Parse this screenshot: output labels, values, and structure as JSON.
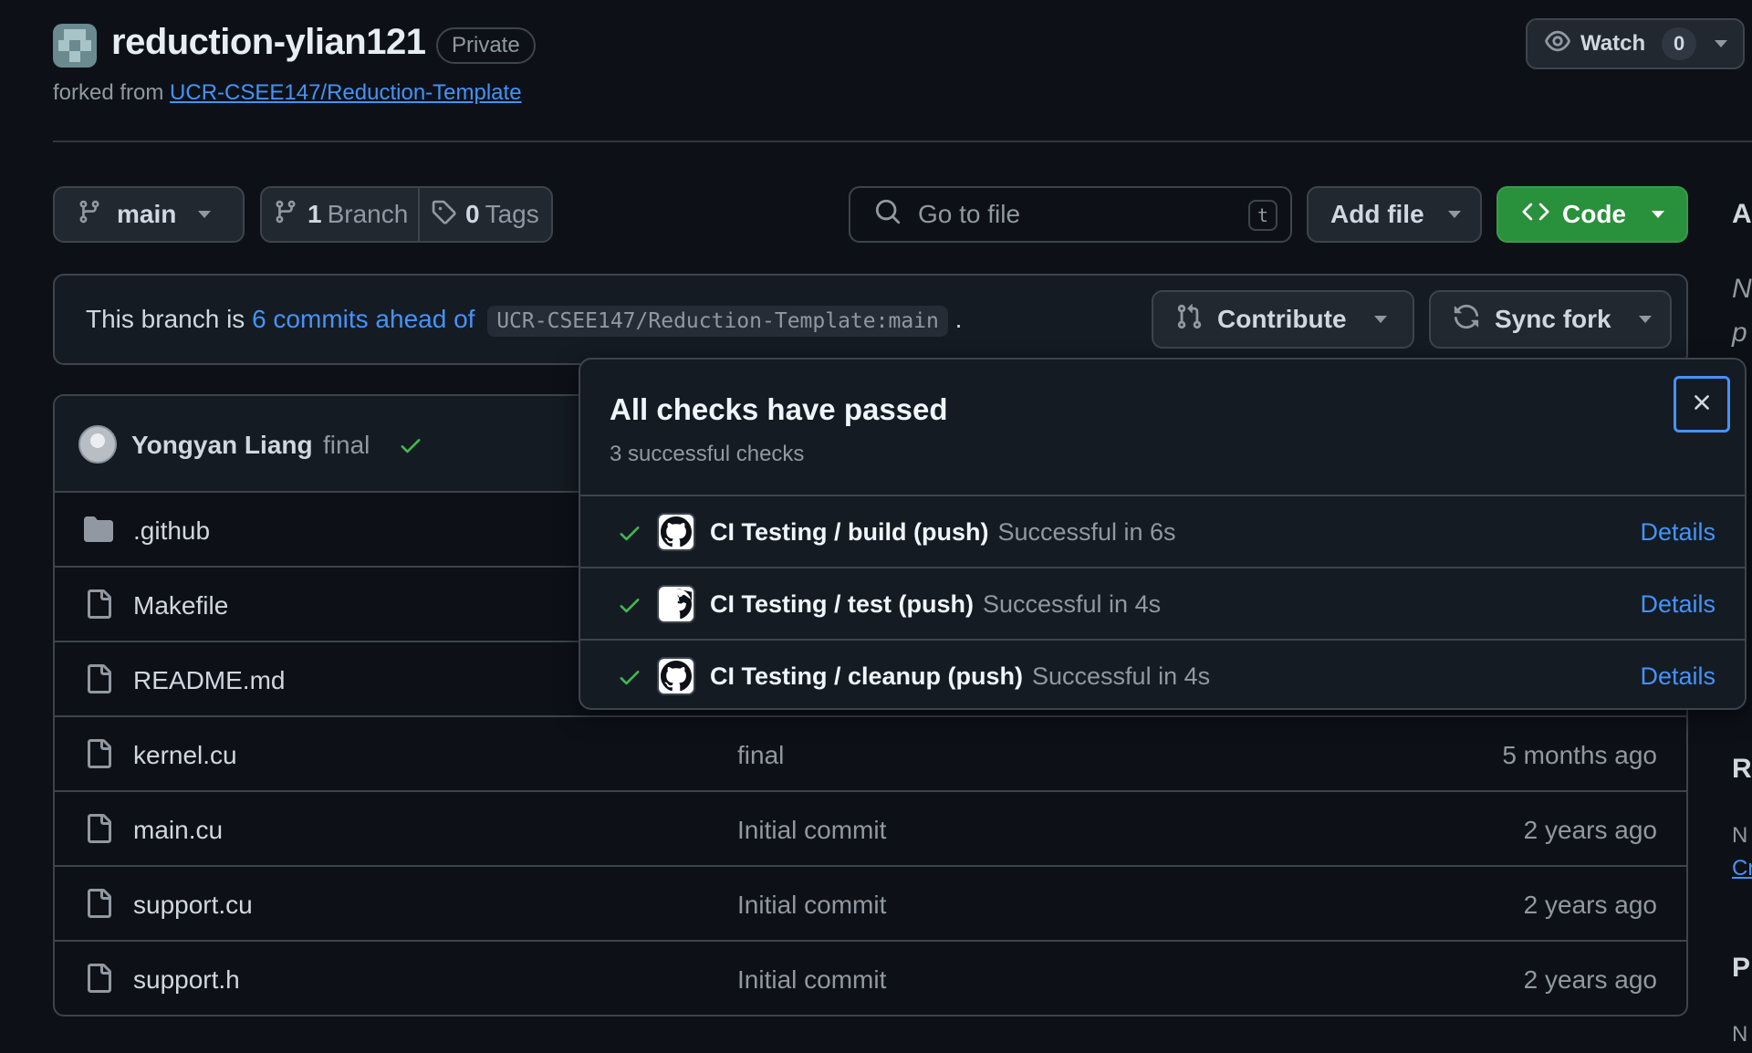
{
  "repo": {
    "name": "reduction-ylian121",
    "visibility": "Private",
    "forked_prefix": "forked from",
    "forked_from": "UCR-CSEE147/Reduction-Template"
  },
  "watch": {
    "label": "Watch",
    "count": "0"
  },
  "toolbar": {
    "branch": "main",
    "branches_count": "1",
    "branches_label": "Branch",
    "tags_count": "0",
    "tags_label": "Tags",
    "search_placeholder": "Go to file",
    "search_shortcut": "t",
    "add_file": "Add file",
    "code": "Code"
  },
  "branch_status": {
    "prefix": "This branch is",
    "link": "6 commits ahead of",
    "ref": "UCR-CSEE147/Reduction-Template:main",
    "suffix": ".",
    "contribute": "Contribute",
    "sync_fork": "Sync fork"
  },
  "latest_commit": {
    "author": "Yongyan Liang",
    "message": "final"
  },
  "files": [
    {
      "name": ".github",
      "type": "folder",
      "message": "",
      "date": ""
    },
    {
      "name": "Makefile",
      "type": "file",
      "message": "",
      "date": ""
    },
    {
      "name": "README.md",
      "type": "file",
      "message": "",
      "date": ""
    },
    {
      "name": "kernel.cu",
      "type": "file",
      "message": "final",
      "date": "5 months ago"
    },
    {
      "name": "main.cu",
      "type": "file",
      "message": "Initial commit",
      "date": "2 years ago"
    },
    {
      "name": "support.cu",
      "type": "file",
      "message": "Initial commit",
      "date": "2 years ago"
    },
    {
      "name": "support.h",
      "type": "file",
      "message": "Initial commit",
      "date": "2 years ago"
    }
  ],
  "checks_popover": {
    "title": "All checks have passed",
    "subtitle": "3 successful checks",
    "checks": [
      {
        "name": "CI Testing / build (push)",
        "status": "Successful in 6s",
        "action": "Details"
      },
      {
        "name": "CI Testing / test (push)",
        "status": "Successful in 4s",
        "action": "Details"
      },
      {
        "name": "CI Testing / cleanup (push)",
        "status": "Successful in 4s",
        "action": "Details"
      }
    ]
  },
  "sidebar_fragments": {
    "a": "A",
    "n": "N",
    "p": "p",
    "r": "R",
    "no": "N",
    "cr": "Cr",
    "pa": "P",
    "no2": "N"
  },
  "colors": {
    "accent": "#4493f8",
    "success": "#3fb950",
    "code_button": "#29903b",
    "background": "#0d1117"
  }
}
